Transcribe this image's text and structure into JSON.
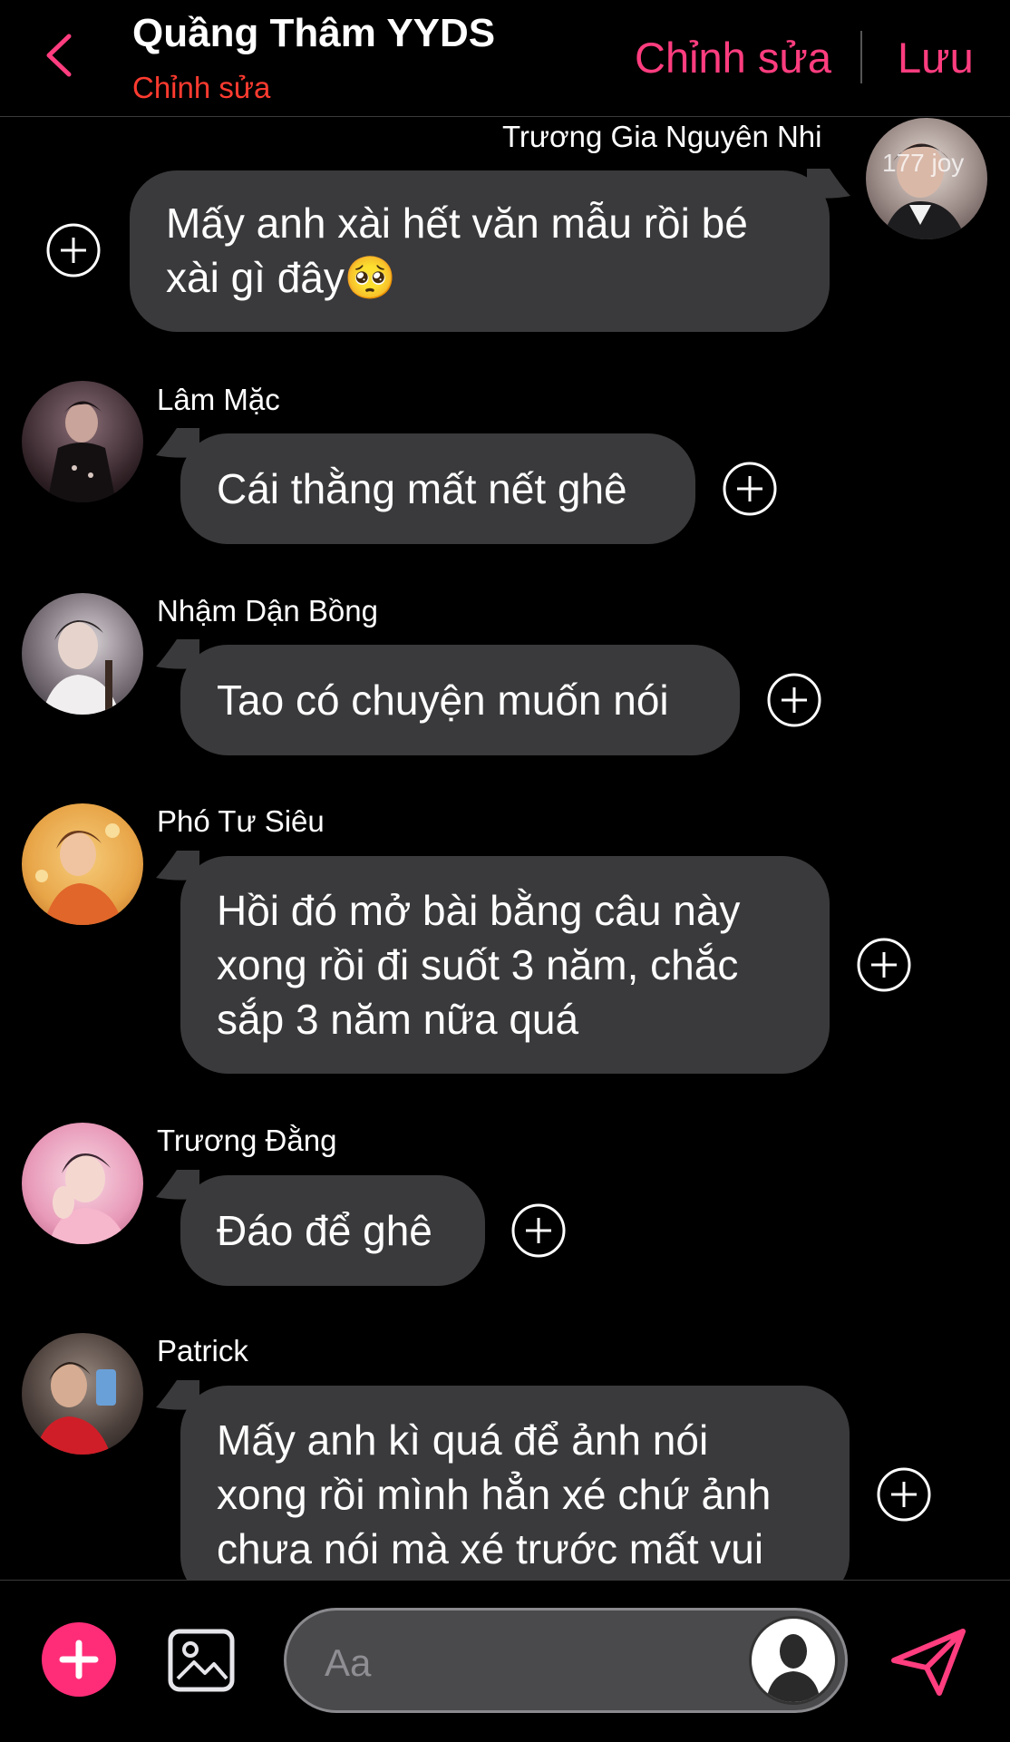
{
  "header": {
    "title": "Quầng Thâm YYDS",
    "subtitle": "Chỉnh sửa",
    "edit_label": "Chỉnh sửa",
    "save_label": "Lưu"
  },
  "messages": [
    {
      "sender": "Trương Gia Nguyên Nhi",
      "lines": [
        "Mấy anh xài hết văn mẫu rồi bé",
        "xài gì đây🥺"
      ],
      "avatar_watermark": "177 joy"
    },
    {
      "sender": "Lâm Mặc",
      "lines": [
        "Cái thằng mất nết ghê"
      ]
    },
    {
      "sender": "Nhậm Dận Bồng",
      "lines": [
        "Tao có chuyện muốn nói"
      ]
    },
    {
      "sender": "Phó Tư Siêu",
      "lines": [
        "Hồi đó mở bài bằng câu này",
        "xong rồi đi suốt 3 năm, chắc",
        "sắp 3 năm nữa quá"
      ]
    },
    {
      "sender": "Trương Đằng",
      "lines": [
        "Đáo để ghê"
      ]
    },
    {
      "sender": "Patrick",
      "lines": [
        "Mấy anh kì quá để ảnh nói",
        "xong rồi mình hẳn xé chứ ảnh",
        "chưa nói mà xé trước mất vui"
      ]
    }
  ],
  "composer": {
    "placeholder": "Aa"
  },
  "colors": {
    "accent": "#ff3d7f",
    "subtitle": "#ff3b30",
    "bubble": "#3a3a3c",
    "background": "#000000"
  },
  "icons": [
    "back-chevron-icon",
    "plus-circle-icon",
    "add-icon",
    "gallery-icon",
    "user-avatar-icon",
    "send-icon"
  ]
}
